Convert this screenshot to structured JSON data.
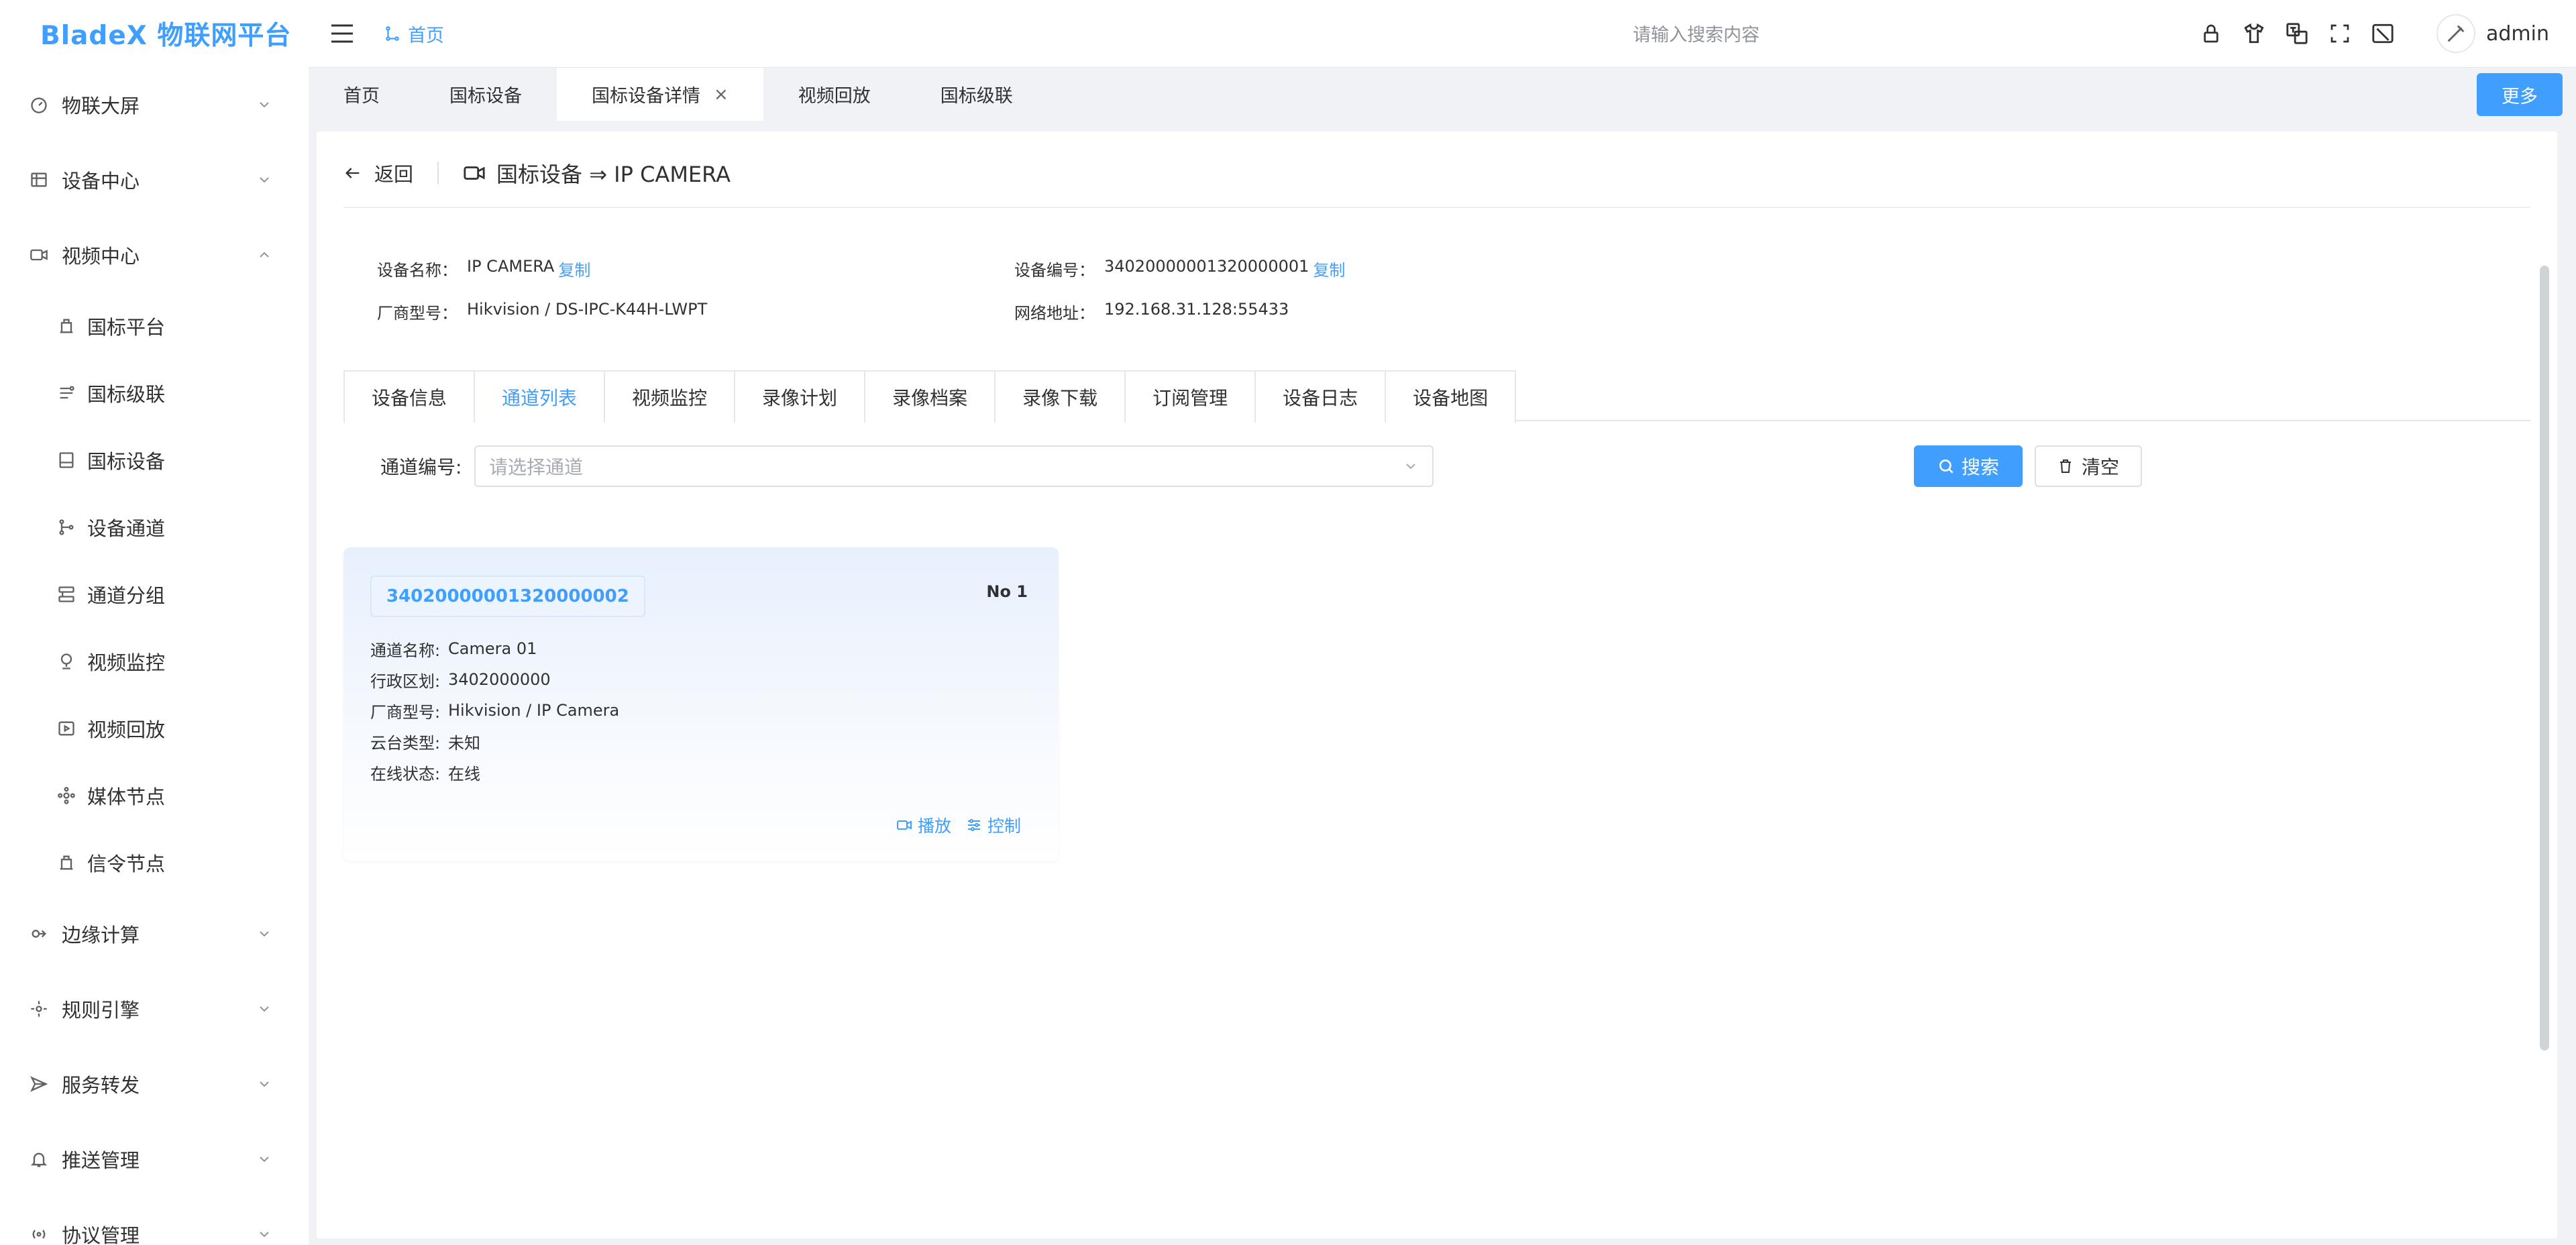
{
  "app": {
    "logo": "BladeX 物联网平台"
  },
  "sidebar": {
    "items": [
      {
        "label": "物联大屏",
        "icon": "dashboard-icon",
        "expanded": false
      },
      {
        "label": "设备中心",
        "icon": "device-center-icon",
        "expanded": false
      },
      {
        "label": "视频中心",
        "icon": "video-camera-icon",
        "expanded": true
      },
      {
        "label": "边缘计算",
        "icon": "edge-compute-icon",
        "expanded": false
      },
      {
        "label": "规则引擎",
        "icon": "rules-engine-icon",
        "expanded": false
      },
      {
        "label": "服务转发",
        "icon": "send-icon",
        "expanded": false
      },
      {
        "label": "推送管理",
        "icon": "bell-icon",
        "expanded": false
      },
      {
        "label": "协议管理",
        "icon": "protocol-icon",
        "expanded": false
      }
    ],
    "video_sub": [
      {
        "label": "国标平台",
        "icon": "platform-icon"
      },
      {
        "label": "国标级联",
        "icon": "cascade-icon"
      },
      {
        "label": "国标设备",
        "icon": "gb-device-icon"
      },
      {
        "label": "设备通道",
        "icon": "channel-icon"
      },
      {
        "label": "通道分组",
        "icon": "group-icon"
      },
      {
        "label": "视频监控",
        "icon": "monitor-icon"
      },
      {
        "label": "视频回放",
        "icon": "playback-icon"
      },
      {
        "label": "媒体节点",
        "icon": "media-node-icon"
      },
      {
        "label": "信令节点",
        "icon": "signal-node-icon"
      }
    ]
  },
  "header": {
    "breadcrumb": "首页",
    "search_placeholder": "请输入搜索内容",
    "user": "admin"
  },
  "tags": {
    "items": [
      {
        "label": "首页",
        "active": false,
        "closable": false
      },
      {
        "label": "国标设备",
        "active": false,
        "closable": false
      },
      {
        "label": "国标设备详情",
        "active": true,
        "closable": true
      },
      {
        "label": "视频回放",
        "active": false,
        "closable": false
      },
      {
        "label": "国标级联",
        "active": false,
        "closable": false
      }
    ],
    "more": "更多",
    "close_glyph": "×"
  },
  "page": {
    "back": "返回",
    "title": "国标设备 ⇒ IP CAMERA",
    "copy_label": "复制",
    "desc": {
      "name_label": "设备名称：",
      "name_value": "IP CAMERA",
      "code_label": "设备编号：",
      "code_value": "34020000001320000001",
      "model_label": "厂商型号：",
      "model_value": "Hikvision / DS-IPC-K44H-LWPT",
      "address_label": "网络地址：",
      "address_value": "192.168.31.128:55433"
    },
    "tabs": [
      "设备信息",
      "通道列表",
      "视频监控",
      "录像计划",
      "录像档案",
      "录像下载",
      "订阅管理",
      "设备日志",
      "设备地图"
    ],
    "active_tab": 1,
    "filter": {
      "label": "通道编号:",
      "placeholder": "请选择通道",
      "search": "搜索",
      "clear": "清空"
    },
    "channel": {
      "id": "34020000001320000002",
      "no": "No 1",
      "fields": [
        {
          "label": "通道名称:",
          "value": "Camera 01"
        },
        {
          "label": "行政区划:",
          "value": "3402000000"
        },
        {
          "label": "厂商型号:",
          "value": "Hikvision / IP Camera"
        },
        {
          "label": "云台类型:",
          "value": "未知"
        },
        {
          "label": "在线状态:",
          "value": "在线"
        }
      ],
      "play": "播放",
      "control": "控制"
    }
  },
  "colors": {
    "accent": "#409eff",
    "text": "#303133",
    "muted": "#909399",
    "border": "#dcdfe6"
  }
}
